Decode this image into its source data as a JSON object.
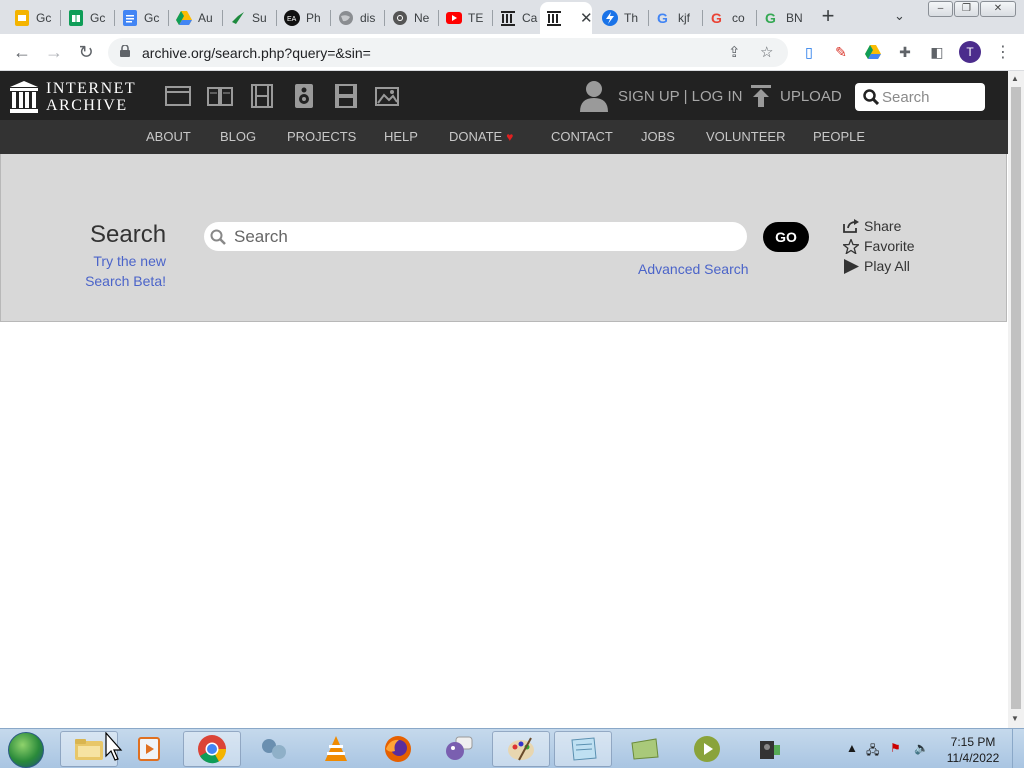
{
  "browser": {
    "tabs": [
      {
        "label": "Gc",
        "icon": "google-slides-icon"
      },
      {
        "label": "Gc",
        "icon": "google-sheets-icon"
      },
      {
        "label": "Gc",
        "icon": "google-docs-icon"
      },
      {
        "label": "Au",
        "icon": "google-drive-icon"
      },
      {
        "label": "Su",
        "icon": "hummingbird-icon"
      },
      {
        "label": "Ph",
        "icon": "ea-icon"
      },
      {
        "label": "dis",
        "icon": "globe-icon"
      },
      {
        "label": "Ne",
        "icon": "chrome-tab-icon"
      },
      {
        "label": "TE",
        "icon": "youtube-icon"
      },
      {
        "label": "Ca",
        "icon": "archive-icon"
      },
      {
        "label": "",
        "icon": "archive-icon",
        "active": true
      },
      {
        "label": "Th",
        "icon": "bolt-icon"
      },
      {
        "label": "kjf",
        "icon": "google-icon"
      },
      {
        "label": "co",
        "icon": "google-icon"
      },
      {
        "label": "BN",
        "icon": "google-icon"
      }
    ],
    "url": "archive.org/search.php?query=&sin=",
    "profile_initial": "T"
  },
  "ia_header": {
    "logo_line1": "INTERNET",
    "logo_line2": "ARCHIVE",
    "signup_login": "SIGN UP | LOG IN",
    "upload": "UPLOAD",
    "search_placeholder": "Search",
    "nav": [
      "ABOUT",
      "BLOG",
      "PROJECTS",
      "HELP",
      "DONATE",
      "CONTACT",
      "JOBS",
      "VOLUNTEER",
      "PEOPLE"
    ]
  },
  "search_band": {
    "title": "Search",
    "beta_line1": "Try the new",
    "beta_line2": "Search Beta!",
    "search_placeholder": "Search",
    "go_label": "GO",
    "advanced_label": "Advanced Search",
    "actions": {
      "share": "Share",
      "favorite": "Favorite",
      "play_all": "Play All"
    }
  },
  "taskbar": {
    "time": "7:15 PM",
    "date": "11/4/2022"
  },
  "colors": {
    "ia_dark": "#222222",
    "ia_nav": "#333333",
    "band": "#d8d8d8",
    "link_blue": "#4b64c9"
  }
}
